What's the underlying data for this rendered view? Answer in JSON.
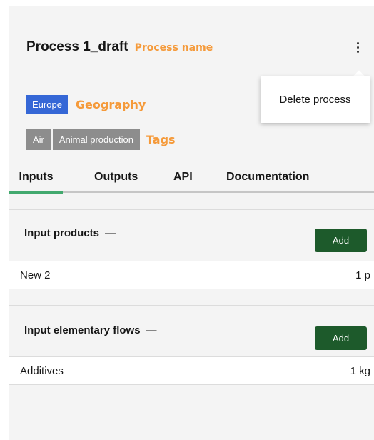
{
  "process": {
    "title": "Process 1_draft",
    "name_annotation": "Process name"
  },
  "menu": {
    "delete_label": "Delete process"
  },
  "geography": {
    "tag": "Europe",
    "annotation": "Geography"
  },
  "tags": {
    "items": [
      "Air",
      "Animal production"
    ],
    "annotation": "Tags"
  },
  "tabs": [
    {
      "label": "Inputs",
      "active": true
    },
    {
      "label": "Outputs",
      "active": false
    },
    {
      "label": "API",
      "active": false
    },
    {
      "label": "Documentation",
      "active": false
    }
  ],
  "sections": [
    {
      "title": "Input products",
      "dash": "—",
      "add_label": "Add",
      "rows": [
        {
          "name": "New 2",
          "quantity": "1 p"
        }
      ]
    },
    {
      "title": "Input elementary flows",
      "dash": "—",
      "add_label": "Add",
      "rows": [
        {
          "name": "Additives",
          "quantity": "1 kg"
        }
      ]
    }
  ],
  "colors": {
    "annotation": "#f59a3a",
    "geography_tag": "#3567d6",
    "tag": "#8d8d8d",
    "add_button": "#1d5a2b",
    "active_tab": "#42a96e"
  }
}
